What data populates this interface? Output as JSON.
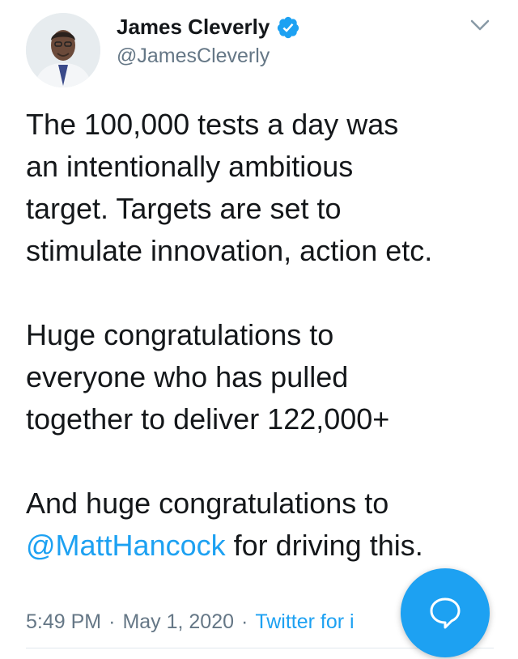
{
  "author": {
    "name": "James Cleverly",
    "handle": "@JamesCleverly",
    "verified": true
  },
  "tweet": {
    "paragraph_1_lines": [
      "The 100,000 tests a day was",
      "an intentionally ambitious",
      "target. Targets are set to",
      "stimulate innovation, action etc."
    ],
    "paragraph_2_lines": [
      "Huge congratulations to",
      "everyone who has pulled",
      "together to deliver 122,000+"
    ],
    "paragraph_3_line_1": "And huge congratulations to",
    "paragraph_3_mention": "@MattHancock",
    "paragraph_3_rest": " for driving this."
  },
  "meta": {
    "time": "5:49 PM",
    "separator": "·",
    "date": "May 1, 2020",
    "source": "Twitter for i"
  },
  "icons": {
    "verified": "verified-badge-icon",
    "menu": "chevron-down-icon",
    "compose": "speech-bubble-icon"
  },
  "colors": {
    "accent": "#1da1f2",
    "text": "#14171a",
    "secondary": "#657786"
  }
}
